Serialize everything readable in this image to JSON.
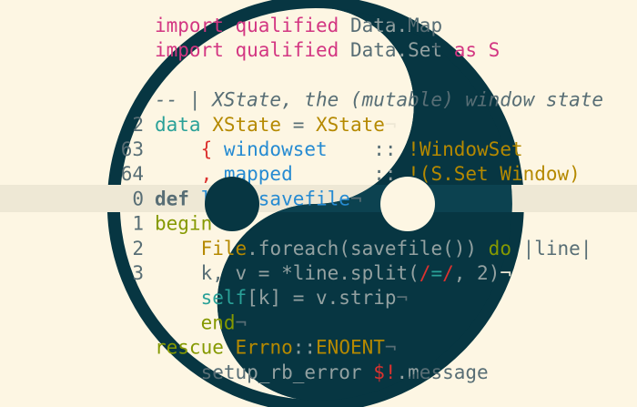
{
  "colors": {
    "background": "#fdf6e3",
    "dark": "#073642",
    "dark_highlight": "#0c4250",
    "light_highlight": "#eee8d5",
    "light_text": "#586e75",
    "dark_text": "#93a1a1",
    "magenta": "#d33682",
    "blue": "#268bd2",
    "yellow": "#b58900",
    "red": "#dc322f",
    "green": "#859900",
    "cyan": "#2aa198",
    "violet": "#6c71c4",
    "comment": "#586e75",
    "whitespace_mark": "#586e75"
  },
  "code": {
    "lines": [
      {
        "segments": [
          {
            "text": "import ",
            "tok": "keyword_magenta"
          },
          {
            "text": "qualified ",
            "tok": "keyword_magenta"
          },
          {
            "text": "Data.Map",
            "tok": "plain"
          }
        ]
      },
      {
        "segments": [
          {
            "text": "import ",
            "tok": "keyword_magenta"
          },
          {
            "text": "qualified ",
            "tok": "keyword_magenta"
          },
          {
            "text": "Data.Set ",
            "tok": "plain"
          },
          {
            "text": "as S",
            "tok": "keyword_magenta"
          }
        ]
      },
      {
        "segments": []
      },
      {
        "segments": [
          {
            "text": "-- | XState, the (mutable) window state",
            "tok": "comment"
          }
        ]
      },
      {
        "number": "2",
        "segments": [
          {
            "text": "data ",
            "tok": "cyan"
          },
          {
            "text": "XState",
            "tok": "yellow"
          },
          {
            "text": " = ",
            "tok": "plain"
          },
          {
            "text": "XState",
            "tok": "yellow"
          },
          {
            "text": "¬",
            "tok": "ws"
          }
        ]
      },
      {
        "number": "63",
        "segments": [
          {
            "text": "    { ",
            "tok": "red"
          },
          {
            "text": "windowset",
            "tok": "blue"
          },
          {
            "text": "    :: ",
            "tok": "plain"
          },
          {
            "text": "!WindowSet",
            "tok": "yellow"
          }
        ]
      },
      {
        "number": "64",
        "segments": [
          {
            "text": "    , ",
            "tok": "red"
          },
          {
            "text": "mapped",
            "tok": "blue"
          },
          {
            "text": "       :: ",
            "tok": "plain"
          },
          {
            "text": "!(S.Set Window)",
            "tok": "yellow"
          }
        ]
      },
      {
        "number": "0",
        "current": true,
        "segments": [
          {
            "text": "def ",
            "tok": "keyword_bold"
          },
          {
            "text": "load_savefile",
            "tok": "blue"
          },
          {
            "text": "¬",
            "tok": "ws"
          }
        ]
      },
      {
        "number": "1",
        "segments": [
          {
            "text": "begin",
            "tok": "green"
          },
          {
            "text": "¬",
            "tok": "ws"
          }
        ]
      },
      {
        "number": "2",
        "segments": [
          {
            "text": "    File",
            "tok": "yellow"
          },
          {
            "text": ".foreach(savefile()) ",
            "tok": "plain"
          },
          {
            "text": "do ",
            "tok": "green"
          },
          {
            "text": "|line|",
            "tok": "plain"
          }
        ]
      },
      {
        "number": "3",
        "segments": [
          {
            "text": "    k, v = *line.split(",
            "tok": "plain"
          },
          {
            "text": "/",
            "tok": "red"
          },
          {
            "text": "=",
            "tok": "cyan"
          },
          {
            "text": "/",
            "tok": "red"
          },
          {
            "text": ", 2)",
            "tok": "plain"
          },
          {
            "text": "¬",
            "tok": "ws"
          }
        ]
      },
      {
        "segments": [
          {
            "text": "    self",
            "tok": "cyan"
          },
          {
            "text": "[k] = v.strip",
            "tok": "plain"
          },
          {
            "text": "¬",
            "tok": "ws"
          }
        ]
      },
      {
        "segments": [
          {
            "text": "    end",
            "tok": "green"
          },
          {
            "text": "¬",
            "tok": "ws"
          }
        ]
      },
      {
        "segments": [
          {
            "text": "rescue ",
            "tok": "green"
          },
          {
            "text": "Errno",
            "tok": "yellow"
          },
          {
            "text": "::",
            "tok": "plain"
          },
          {
            "text": "ENOENT",
            "tok": "yellow"
          },
          {
            "text": "¬",
            "tok": "ws"
          }
        ]
      },
      {
        "segments": [
          {
            "text": "    setup_rb_error ",
            "tok": "plain"
          },
          {
            "text": "$!",
            "tok": "red"
          },
          {
            "text": ".message",
            "tok": "plain"
          }
        ]
      }
    ]
  }
}
